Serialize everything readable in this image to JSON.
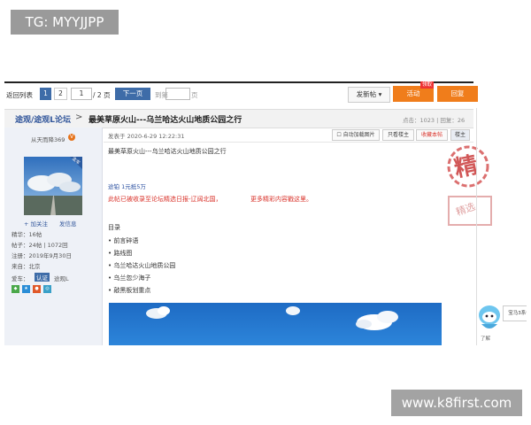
{
  "watermarks": {
    "top": "TG: MYYJJPP",
    "bottom": "www.k8first.com"
  },
  "pager": {
    "back_label": "返回列表",
    "pages": [
      "1",
      "2"
    ],
    "current_input": "1",
    "total": "/ 2 页",
    "next_label": "下一页",
    "go_label": "到第",
    "page_label": "页"
  },
  "toolbar": {
    "new_post": "发新帖",
    "activity": "活动",
    "activity_badge": "领取",
    "reply": "回复"
  },
  "thread": {
    "breadcrumb": "途观/途观L论坛",
    "arrow": ">",
    "title": "最美草原火山---乌兰哈达火山地质公园之行",
    "stats": "点击：1023 | 回复：26"
  },
  "user": {
    "name": "从天而降369",
    "vip": "V",
    "avatar_badge": "金车",
    "follow": "+ 加关注",
    "message": "发信息",
    "meta": [
      "精华：16帖",
      "帖子：24帖 | 1072回",
      "注册：2019年9月30日",
      "来自：北京"
    ],
    "car_label": "爱车：",
    "car_tag": "认证",
    "car_model": "途观L"
  },
  "post": {
    "date": "发表于 2020-6-29 12:22:31",
    "buttons": [
      "只看楼主",
      "收藏本帖",
      "楼主"
    ],
    "auto_load": "自动加载图片",
    "title_text": "最美草原火山---乌兰哈达火山地质公园之行",
    "reward": "途铂 1元抵5万",
    "featured_line": "此帖已被收录至论坛精选日报-辽阔北国，",
    "more_link": "更多精彩内容戳这里。",
    "toc_title": "目录",
    "toc": [
      "• 前言碎语",
      "• 路线图",
      "• 乌兰哈达火山地质公园",
      "• 乌兰忽少海子",
      "• 敲黑板划重点"
    ]
  },
  "stamp": {
    "main": "精",
    "sub": "精选"
  },
  "mascot": {
    "label": "了解",
    "bubble": "宝马3系备"
  },
  "colors": {
    "accent_blue": "#3e6ca8",
    "orange": "#f07d1b",
    "red_text": "#d9322a",
    "link_blue": "#2a4fa0"
  }
}
